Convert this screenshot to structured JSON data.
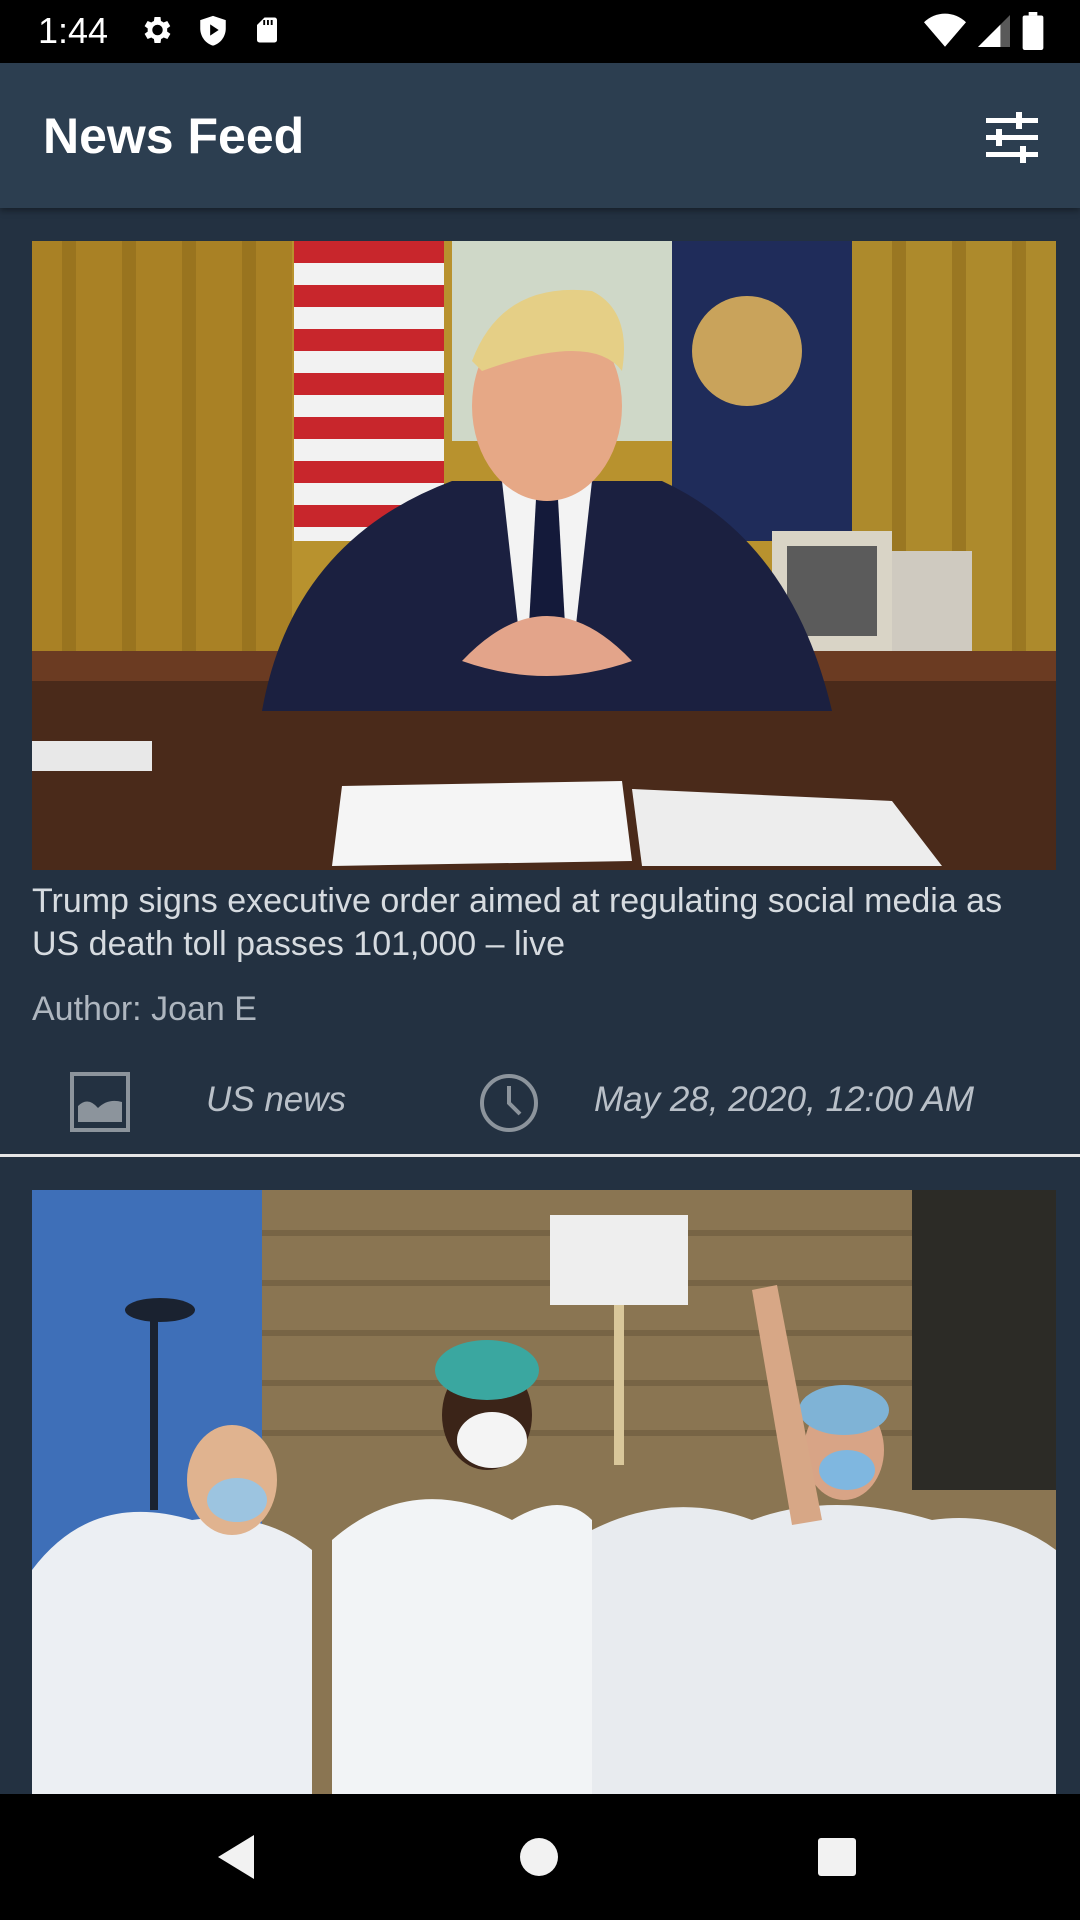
{
  "status_bar": {
    "time": "1:44",
    "left_icons": [
      "gear-icon",
      "shield-play-icon",
      "sd-card-icon"
    ],
    "right_icons": [
      "wifi-icon",
      "signal-icon",
      "battery-icon"
    ]
  },
  "app_bar": {
    "title": "News Feed",
    "filter_icon": "tune-sliders-icon"
  },
  "feed": {
    "articles": [
      {
        "image": "photo-trump-oval-office",
        "title": "Trump signs executive order aimed at regulating social media as US death toll passes 101,000 – live",
        "author": "Author: Joan E",
        "section": "US news",
        "date": "May 28, 2020, 12:00 AM"
      },
      {
        "image": "photo-nurses-protest"
      }
    ]
  },
  "nav_bar": {
    "buttons": [
      "back-icon",
      "home-icon",
      "recents-icon"
    ]
  },
  "colors": {
    "background": "#233141",
    "app_bar": "#2c3e50",
    "text_primary": "#d6dbe0",
    "text_meta": "#b9c0c8",
    "divider": "#e6e6e6"
  }
}
